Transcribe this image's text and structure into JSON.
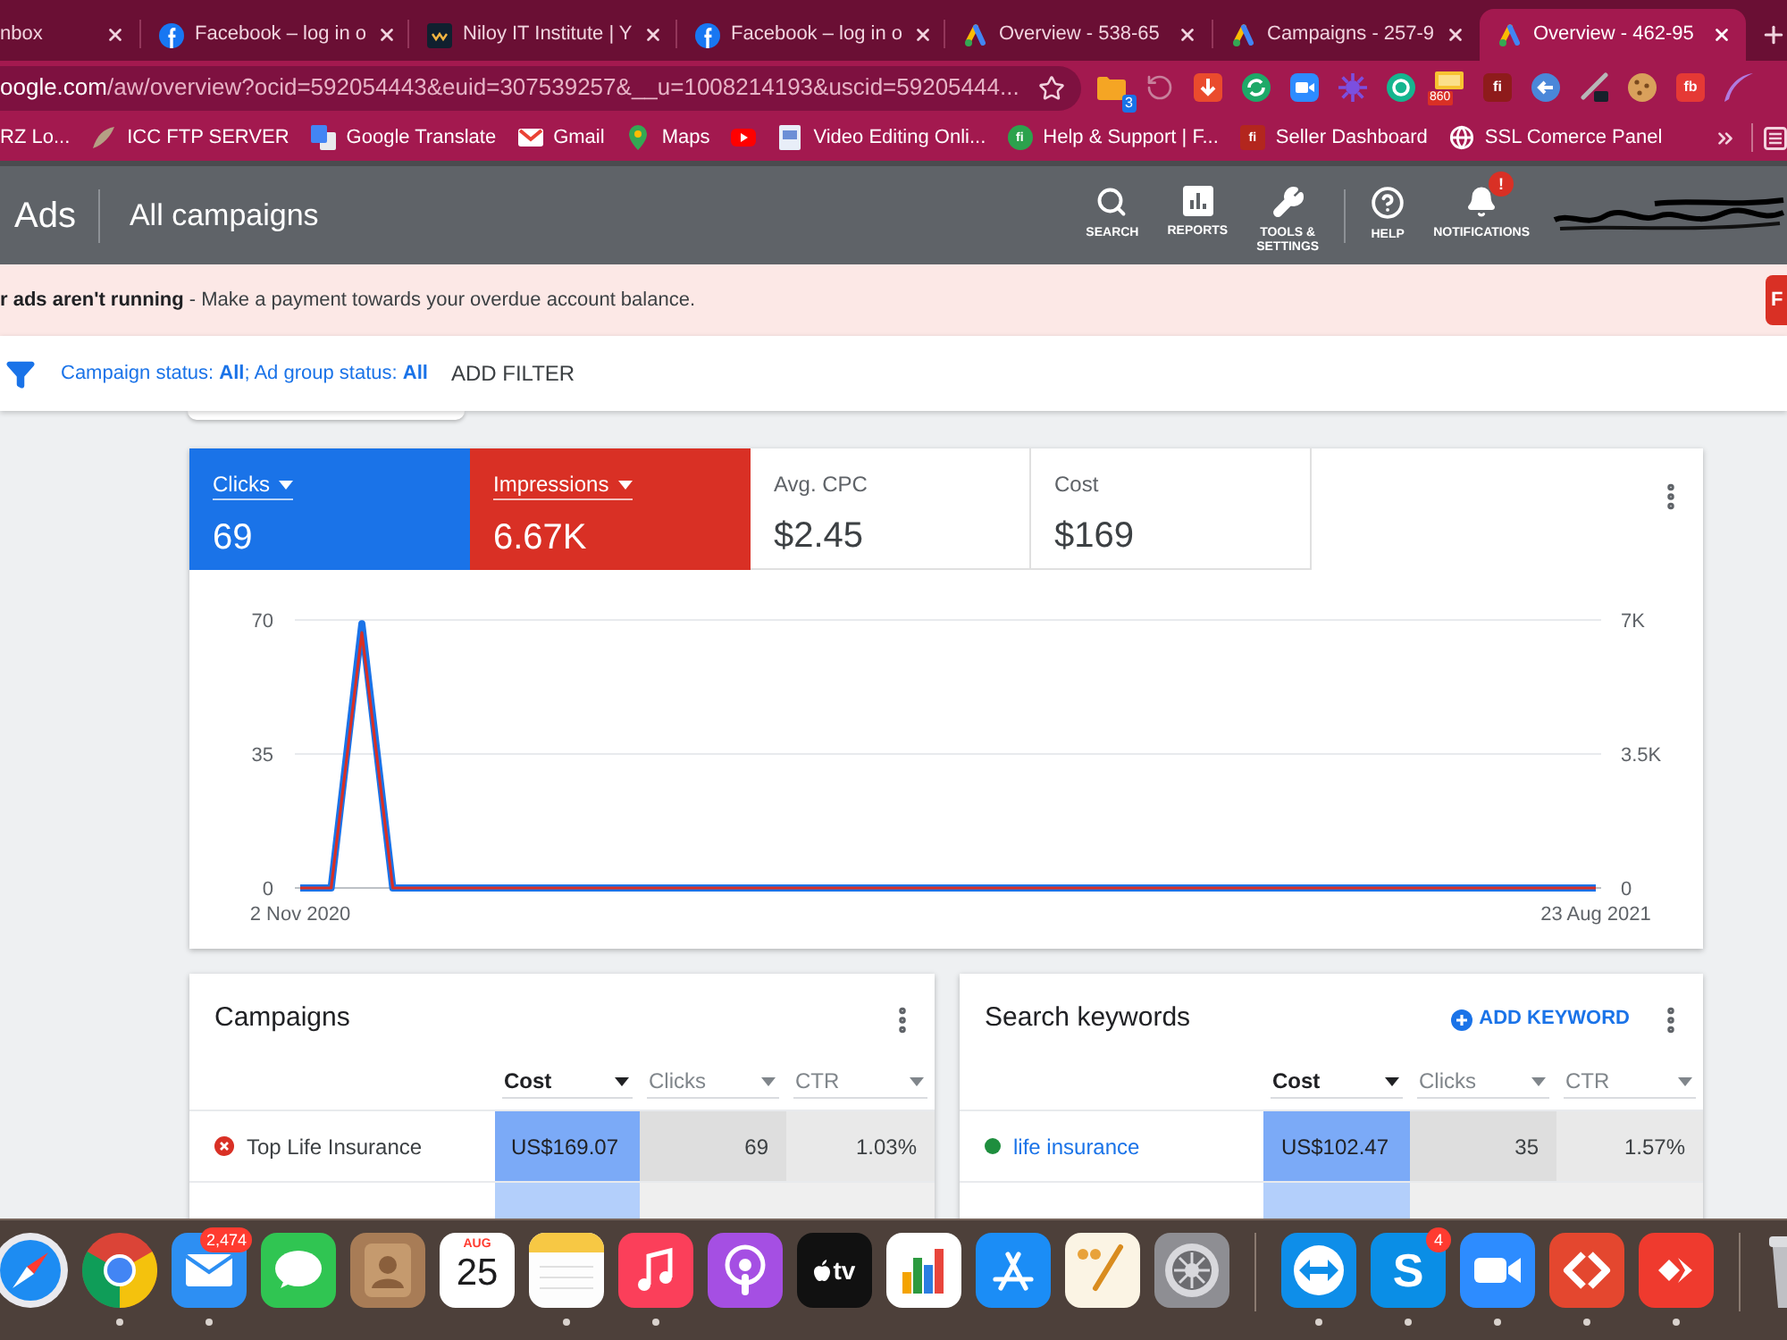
{
  "browser": {
    "tabs": [
      {
        "title": "nbox",
        "selected": false
      },
      {
        "title": "Facebook – log in o",
        "kind": "f-circle",
        "selected": false
      },
      {
        "title": "Niloy IT Institute | Y",
        "kind": "dark-square",
        "selected": false
      },
      {
        "title": "Facebook – log in o",
        "kind": "f-circle",
        "selected": false
      },
      {
        "title": "Overview - 538-65",
        "kind": "ads-triangle",
        "selected": false
      },
      {
        "title": "Campaigns - 257-9",
        "kind": "ads-triangle",
        "selected": false
      },
      {
        "title": "Overview - 462-95",
        "kind": "ads-triangle",
        "selected": true
      }
    ],
    "address": {
      "host": "oogle.com",
      "path": "/aw/overview?ocid=592054443&euid=307539257&__u=1008214193&uscid=59205444..."
    },
    "extensions": [
      {
        "kind": "folder",
        "badge": "3"
      },
      {
        "kind": "history"
      },
      {
        "kind": "download"
      },
      {
        "kind": "refresh"
      },
      {
        "kind": "camera"
      },
      {
        "kind": "burst"
      },
      {
        "kind": "ring"
      },
      {
        "kind": "ticket",
        "badge": "860"
      },
      {
        "kind": "letters",
        "text": "fi",
        "color": "#8e1b1b"
      },
      {
        "kind": "back-arrow"
      },
      {
        "kind": "pen"
      },
      {
        "kind": "cookie"
      },
      {
        "kind": "letters",
        "text": "fb",
        "color": "#e53935"
      },
      {
        "kind": "feather"
      }
    ],
    "bookmarks": [
      {
        "label": "RZ Lo..."
      },
      {
        "label": "ICC FTP SERVER",
        "kind": "leaf"
      },
      {
        "label": "Google Translate",
        "kind": "translate"
      },
      {
        "label": "Gmail",
        "kind": "envelope"
      },
      {
        "label": "Maps",
        "kind": "pin"
      },
      {
        "kind": "play"
      },
      {
        "label": "Video Editing Onli...",
        "kind": "page"
      },
      {
        "label": "Help & Support | F...",
        "kind": "letter-circle",
        "icon_text": "fi"
      },
      {
        "label": "Seller Dashboard",
        "kind": "letter-square",
        "icon_text": "fi"
      },
      {
        "label": "SSL Comerce Panel",
        "kind": "globe"
      }
    ]
  },
  "ads_header": {
    "product": "Ads",
    "page_title": "All campaigns",
    "actions": [
      {
        "kind": "search",
        "label": "SEARCH"
      },
      {
        "kind": "reports",
        "label": "REPORTS"
      },
      {
        "kind": "tools",
        "label": "TOOLS & SETTINGS"
      }
    ],
    "account_actions": [
      {
        "kind": "help",
        "label": "HELP"
      },
      {
        "kind": "notifications",
        "label": "NOTIFICATIONS",
        "badge": "!"
      }
    ]
  },
  "alert": {
    "text": "**r ads aren't running** - Make a payment towards your overdue account balance.",
    "action": "F"
  },
  "filters": {
    "summary": "Campaign status: **All**; Ad group status: **All**",
    "add": "ADD FILTER"
  },
  "overview": {
    "metrics": [
      {
        "label": "Clicks",
        "value": "69",
        "selected": true,
        "color": "#1a73e8"
      },
      {
        "label": "Impressions",
        "value": "6.67K",
        "selected": true,
        "color": "#d93025"
      },
      {
        "label": "Avg. CPC",
        "value": "$2.45",
        "selected": false
      },
      {
        "label": "Cost",
        "value": "$169",
        "selected": false
      }
    ],
    "chart_data": {
      "type": "line",
      "categories": [
        "2 Nov 2020",
        null,
        null,
        null,
        null,
        null,
        null,
        null,
        null,
        null,
        null,
        null,
        null,
        null,
        null,
        null,
        null,
        null,
        null,
        null,
        null,
        null,
        null,
        null,
        null,
        null,
        null,
        null,
        null,
        null,
        null,
        null,
        null,
        null,
        null,
        null,
        null,
        null,
        null,
        null,
        null,
        null,
        "23 Aug 2021"
      ],
      "series": [
        {
          "color": "#1a73e8",
          "values": [
            0,
            0,
            69,
            0,
            0,
            0,
            0,
            0,
            0,
            0,
            0,
            0,
            0,
            0,
            0,
            0,
            0,
            0,
            0,
            0,
            0,
            0,
            0,
            0,
            0,
            0,
            0,
            0,
            0,
            0,
            0,
            0,
            0,
            0,
            0,
            0,
            0,
            0,
            0,
            0,
            0,
            0,
            0
          ]
        },
        {
          "color": "#d93025",
          "axis": "y2",
          "values": [
            0,
            0,
            6670,
            0,
            0,
            0,
            0,
            0,
            0,
            0,
            0,
            0,
            0,
            0,
            0,
            0,
            0,
            0,
            0,
            0,
            0,
            0,
            0,
            0,
            0,
            0,
            0,
            0,
            0,
            0,
            0,
            0,
            0,
            0,
            0,
            0,
            0,
            0,
            0,
            0,
            0,
            0,
            0
          ]
        }
      ],
      "ylim": [
        0,
        70
      ],
      "yticks": [
        0,
        35,
        70
      ],
      "y2lim": [
        0,
        7000
      ],
      "y2ticks": [
        0,
        {
          "value": 3500,
          "label": "3.5K"
        },
        {
          "value": 7000,
          "label": "7K"
        }
      ],
      "grid": true
    }
  },
  "campaigns": {
    "title": "Campaigns",
    "columns": [
      {
        "label": "Cost",
        "sorted": true
      },
      {
        "label": "Clicks",
        "sorted": false
      },
      {
        "label": "CTR",
        "sorted": false
      }
    ],
    "rows": [
      {
        "eligible": false,
        "name": "Top Life Insurance",
        "link": false,
        "cells": [
          "US$169.07",
          "69",
          "1.03%"
        ]
      }
    ]
  },
  "keywords": {
    "title": "Search keywords",
    "action": "ADD KEYWORD",
    "columns": [
      {
        "label": "Cost",
        "sorted": true
      },
      {
        "label": "Clicks",
        "sorted": false
      },
      {
        "label": "CTR",
        "sorted": false
      }
    ],
    "rows": [
      {
        "eligible": true,
        "name": "life insurance",
        "link": true,
        "cells": [
          "US$102.47",
          "35",
          "1.57%"
        ]
      }
    ]
  },
  "dock": {
    "apps": [
      {
        "kind": "safari",
        "running": false
      },
      {
        "kind": "chrome",
        "running": true
      },
      {
        "kind": "mail",
        "badge": "2,474",
        "running": true
      },
      {
        "kind": "messages",
        "running": false
      },
      {
        "kind": "contacts",
        "running": false
      },
      {
        "kind": "calendar",
        "month": "AUG",
        "day": "25",
        "running": false
      },
      {
        "kind": "notes",
        "running": true
      },
      {
        "kind": "music",
        "running": true
      },
      {
        "kind": "podcasts",
        "running": false
      },
      {
        "kind": "tv",
        "label": "tv",
        "running": false
      },
      {
        "kind": "numbers",
        "running": false
      },
      {
        "kind": "app-store",
        "running": false
      },
      {
        "kind": "pages",
        "running": false
      },
      {
        "kind": "settings",
        "running": false
      },
      {
        "kind": "separator"
      },
      {
        "kind": "teamviewer",
        "running": true
      },
      {
        "kind": "skype",
        "letter": "S",
        "badge": "4",
        "running": true
      },
      {
        "kind": "zoom",
        "running": true
      },
      {
        "kind": "remote",
        "running": true
      },
      {
        "kind": "diamond",
        "running": true
      },
      {
        "kind": "separator"
      },
      {
        "kind": "trash",
        "running": false
      }
    ]
  }
}
